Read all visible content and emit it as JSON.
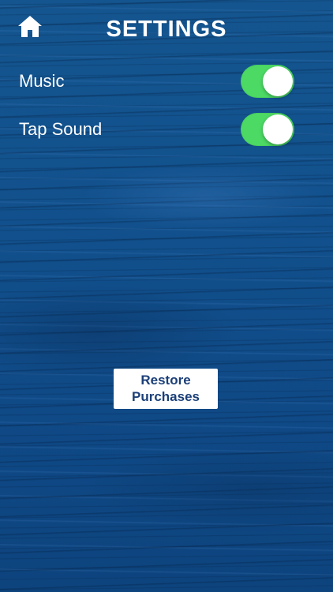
{
  "header": {
    "title": "SETTINGS",
    "home_icon": "home-icon"
  },
  "settings": [
    {
      "label": "Music",
      "enabled": true
    },
    {
      "label": "Tap Sound",
      "enabled": true
    }
  ],
  "restore_button": {
    "line1": "Restore",
    "line2": "Purchases"
  },
  "colors": {
    "background": "#124f8e",
    "toggle_on": "#4cd964",
    "button_text": "#1b3f78",
    "text": "#ffffff"
  }
}
